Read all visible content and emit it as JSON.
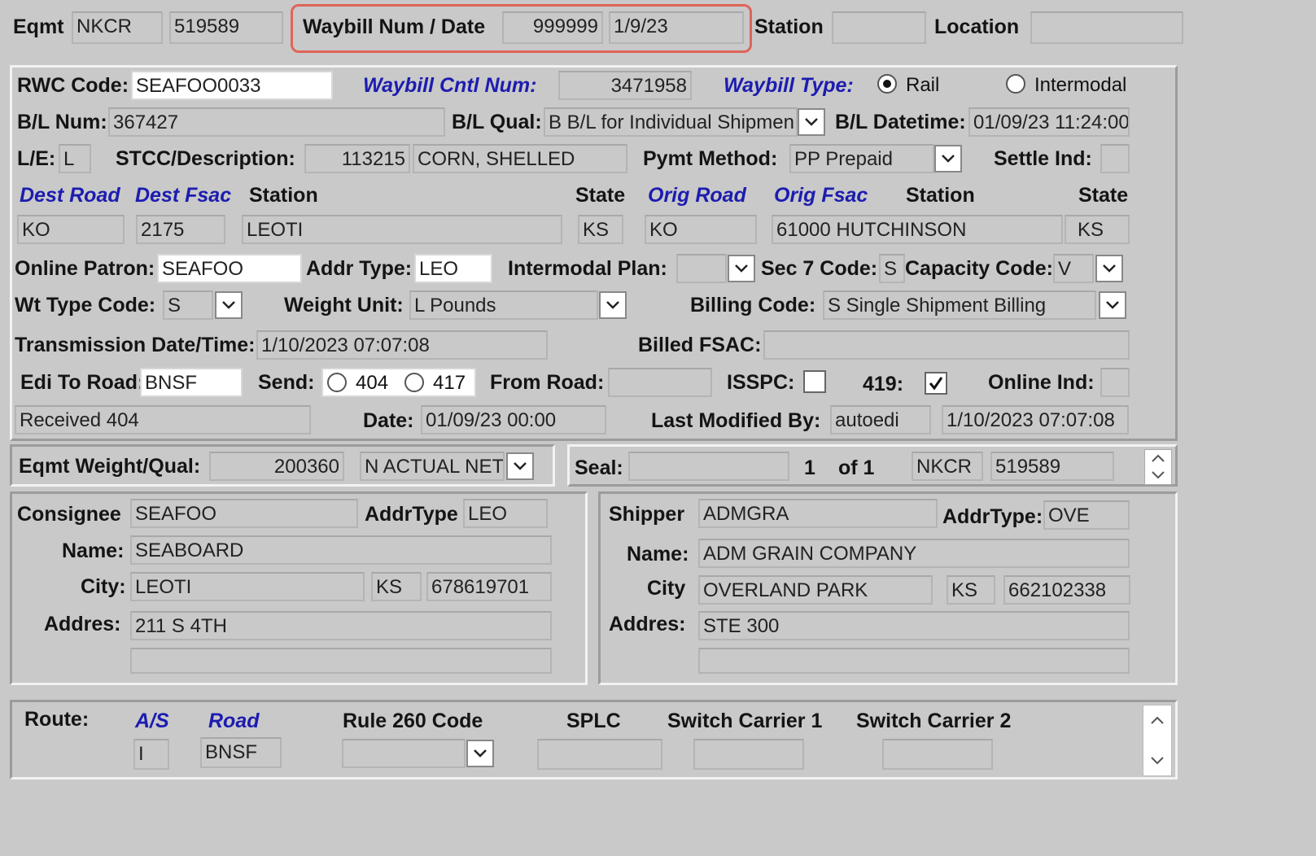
{
  "header": {
    "eqmt_label": "Eqmt",
    "eqmt_initial": "NKCR",
    "eqmt_number": "519589",
    "waybill_label": "Waybill Num / Date",
    "waybill_num": "999999",
    "waybill_date": "1/9/23",
    "station_label": "Station",
    "station_value": "",
    "location_label": "Location",
    "location_value": ""
  },
  "main": {
    "rwc_label": "RWC Code:",
    "rwc_value": "SEAFOO0033",
    "waybill_cntl_label": "Waybill Cntl Num:",
    "waybill_cntl_value": "3471958",
    "waybill_type_label": "Waybill Type:",
    "waybill_type_rail": "Rail",
    "waybill_type_intermodal": "Intermodal",
    "waybill_type_selected": "Rail",
    "bl_num_label": "B/L Num:",
    "bl_num_value": "367427",
    "bl_qual_label": "B/L Qual:",
    "bl_qual_value": "B B/L for Individual Shipmen",
    "bl_datetime_label": "B/L Datetime:",
    "bl_datetime_value": "01/09/23 11:24:00",
    "le_label": "L/E:",
    "le_value": "L",
    "stcc_label": "STCC/Description:",
    "stcc_code": "113215",
    "stcc_desc": "CORN, SHELLED",
    "pymt_label": "Pymt Method:",
    "pymt_value": "PP Prepaid",
    "settle_label": "Settle Ind:",
    "settle_value": "",
    "dest_road_label": "Dest Road",
    "dest_fsac_label": "Dest Fsac",
    "dest_station_label": "Station",
    "dest_state_label": "State",
    "orig_road_label": "Orig Road",
    "orig_fsac_label": "Orig Fsac",
    "orig_station_label": "Station",
    "orig_state_label": "State",
    "dest_road": "KO",
    "dest_fsac": "2175",
    "dest_station": "LEOTI",
    "dest_state": "KS",
    "orig_road": "KO",
    "orig_fsac_station": "61000  HUTCHINSON",
    "orig_state": "KS",
    "online_patron_label": "Online Patron:",
    "online_patron_value": "SEAFOO",
    "addr_type_label": "Addr Type:",
    "addr_type_value": "LEO",
    "intermodal_plan_label": "Intermodal Plan:",
    "intermodal_plan_value": "",
    "sec7_label": "Sec 7 Code:",
    "sec7_value": "S",
    "capacity_label": "Capacity Code:",
    "capacity_value": "V",
    "wt_type_label": "Wt Type Code:",
    "wt_type_value": "S",
    "weight_unit_label": "Weight Unit:",
    "weight_unit_value": "L Pounds",
    "billing_label": "Billing Code:",
    "billing_value": "S Single Shipment Billing",
    "transmission_label": "Transmission Date/Time:",
    "transmission_value": "1/10/2023 07:07:08",
    "billed_fsac_label": "Billed FSAC:",
    "billed_fsac_value": "",
    "edi_label": "Edi To Road:",
    "edi_value": "BNSF",
    "send_label": "Send:",
    "send_404": "404",
    "send_417": "417",
    "from_road_label": "From Road:",
    "from_road_value": "",
    "isspc_label": "ISSPC:",
    "isspc_checked": false,
    "l419_label": "419:",
    "l419_checked": true,
    "online_ind_label": "Online Ind:",
    "online_ind_value": "",
    "received_value": "Received 404",
    "date_label": "Date:",
    "date_value": "01/09/23 00:00",
    "last_mod_label": "Last Modified By:",
    "last_mod_user": "autoedi",
    "last_mod_time": "1/10/2023 07:07:08"
  },
  "weight": {
    "label": "Eqmt Weight/Qual:",
    "value": "200360",
    "qual": "N ACTUAL NET"
  },
  "seal": {
    "label": "Seal:",
    "value": "",
    "index": "1",
    "of": "of 1",
    "initial": "NKCR",
    "number": "519589"
  },
  "consignee": {
    "label": "Consignee",
    "code": "SEAFOO",
    "addrtype_label": "AddrType",
    "addrtype_value": "LEO",
    "name_label": "Name:",
    "name_value": "SEABOARD",
    "city_label": "City:",
    "city_value": "LEOTI",
    "state_value": "KS",
    "zip_value": "678619701",
    "address_label": "Addres:",
    "address1": "211 S 4TH",
    "address2": ""
  },
  "shipper": {
    "label": "Shipper",
    "code": "ADMGRA",
    "addrtype_label": "AddrType:",
    "addrtype_value": "OVE",
    "name_label": "Name:",
    "name_value": "ADM GRAIN COMPANY",
    "city_label": "City",
    "city_value": "OVERLAND PARK",
    "state_value": "KS",
    "zip_value": "662102338",
    "address_label": "Addres:",
    "address1": "STE 300",
    "address2": ""
  },
  "route": {
    "label": "Route:",
    "as_label": "A/S",
    "road_label": "Road",
    "rule260_label": "Rule 260 Code",
    "splc_label": "SPLC",
    "switch1_label": "Switch Carrier 1",
    "switch2_label": "Switch Carrier 2",
    "as_value": "I",
    "road_value": "BNSF",
    "rule260_value": "",
    "splc_value": "",
    "switch1_value": "",
    "switch2_value": ""
  },
  "icons": {
    "dropdown": "chevron-down-icon",
    "spin_up": "chevron-up-icon",
    "spin_down": "chevron-down-icon",
    "check": "checkmark-icon"
  },
  "colors": {
    "background": "#c9c9c9",
    "blue_label": "#1c1cb0",
    "highlight": "#e06458"
  }
}
